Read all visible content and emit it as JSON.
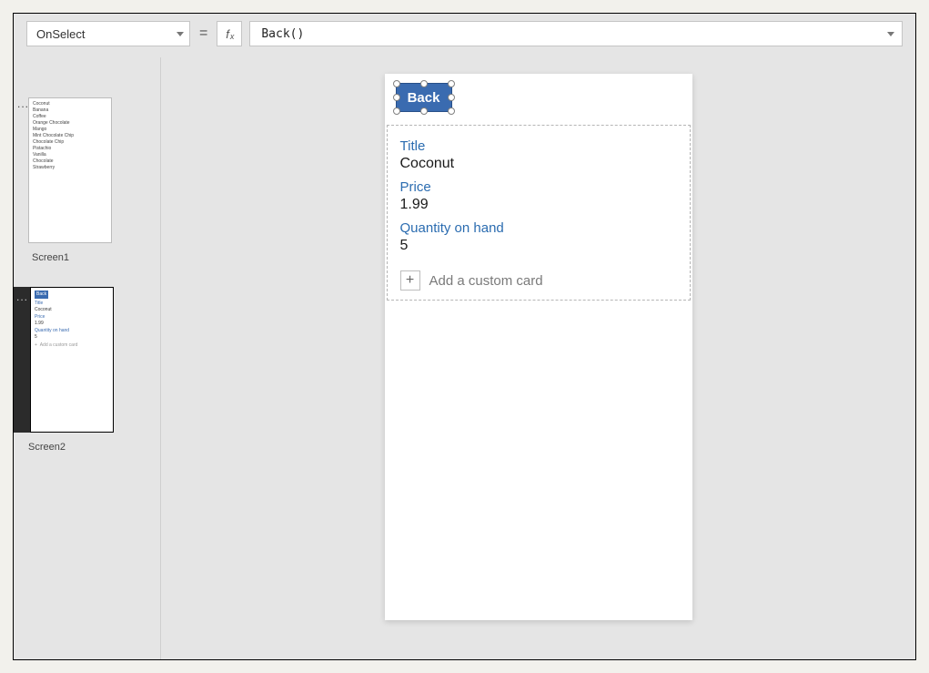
{
  "formula_bar": {
    "property": "OnSelect",
    "equals": "=",
    "fx": "fx",
    "formula": "Back()"
  },
  "thumbnails": {
    "screen1": {
      "label": "Screen1",
      "items": [
        "Coconut",
        "Banana",
        "Coffee",
        "Orange Chocolate",
        "Mango",
        "Mint Chocolate Chip",
        "Chocolate Chip",
        "Pistachio",
        "Vanilla",
        "Chocolate",
        "Strawberry"
      ]
    },
    "screen2": {
      "label": "Screen2",
      "back": "Back",
      "fields": {
        "title_label": "Title",
        "title_value": "Coconut",
        "price_label": "Price",
        "price_value": "1.99",
        "qty_label": "Quantity on hand",
        "qty_value": "5",
        "add_custom": "Add a custom card"
      }
    }
  },
  "canvas": {
    "back_label": "Back",
    "fields": [
      {
        "label": "Title",
        "value": "Coconut"
      },
      {
        "label": "Price",
        "value": "1.99"
      },
      {
        "label": "Quantity on hand",
        "value": "5"
      }
    ],
    "add_custom_card": "Add a custom card"
  },
  "icons": {
    "more": "...",
    "plus": "+"
  }
}
